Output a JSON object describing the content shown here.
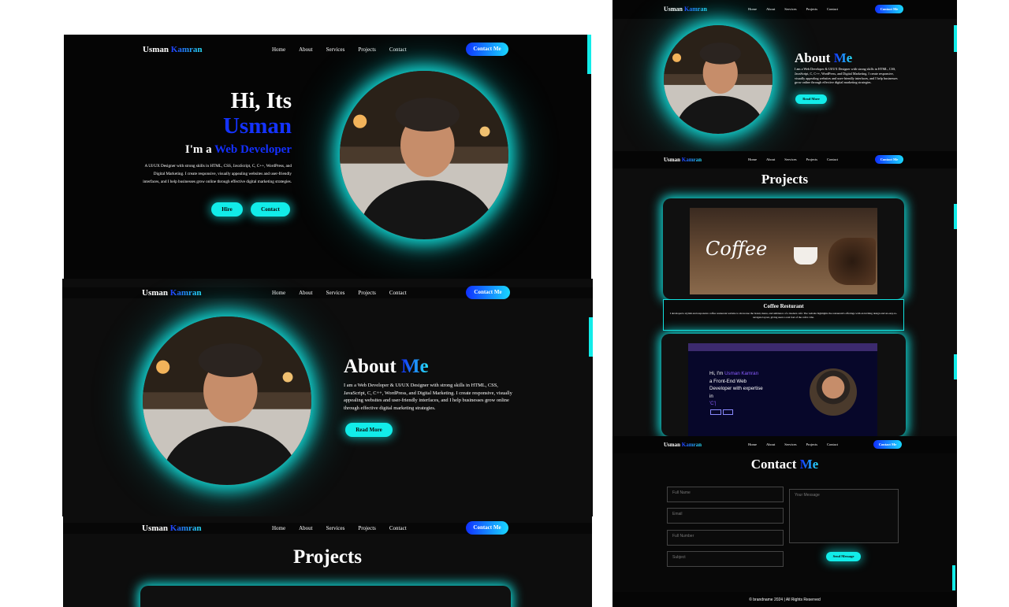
{
  "brand": {
    "first": "Usman",
    "last": "Kamran"
  },
  "nav": {
    "items": [
      "Home",
      "About",
      "Services",
      "Projects",
      "Contact"
    ],
    "cta": "Contact Me"
  },
  "hero": {
    "line1": "Hi, Its",
    "name": "Usman",
    "role_prefix": "I'm a",
    "role": "Web Developer",
    "desc": "A UI/UX Designer with strong skills in HTML, CSS, JavaScript, C, C++, WordPress, and Digital Marketing. I create responsive, visually appealing websites and user-friendly interfaces, and I help businesses grow online through effective digital marketing strategies.",
    "btn_hire": "Hire",
    "btn_contact": "Contact"
  },
  "about": {
    "title_a": "About",
    "title_b": "Me",
    "desc": "I am a Web Developer & UI/UX Designer with strong skills in HTML, CSS, JavaScript, C, C++, WordPress, and Digital Marketing. I create responsive, visually appealing websites and user-friendly interfaces, and I help businesses grow online through effective digital marketing strategies.",
    "btn": "Read More"
  },
  "projects": {
    "title": "Projects",
    "p1_title": "Coffee Resturant",
    "p1_brand": "Coffee",
    "p1_desc": "I developed a stylish and responsive coffee restaurant website to showcase the brand, menu, and ambiance of a modern café. The website highlights the restaurant's offerings with an inviting design and an easy-to-navigate layout, giving users a real feel of the cafe's vibe.",
    "p2_hi": "Hi, I'm",
    "p2_name": "Usman Kamran",
    "p2_line2": "a Front-End Web",
    "p2_line3": "Developer with expertise",
    "p2_line4": "in",
    "p2_line5": "'C'|"
  },
  "contact": {
    "title_a": "Contact",
    "title_b": "Me",
    "fields": {
      "name": "Full Name",
      "email": "Email",
      "phone": "Full Number",
      "subject": "Subject",
      "message": "Your Message"
    },
    "btn": "Send Message"
  },
  "footer": {
    "text": "© brandname 2024 | All Rights Reserved"
  },
  "colors": {
    "accent_cyan": "#12ece9",
    "accent_blue": "#1430ff",
    "background": "#070707"
  }
}
